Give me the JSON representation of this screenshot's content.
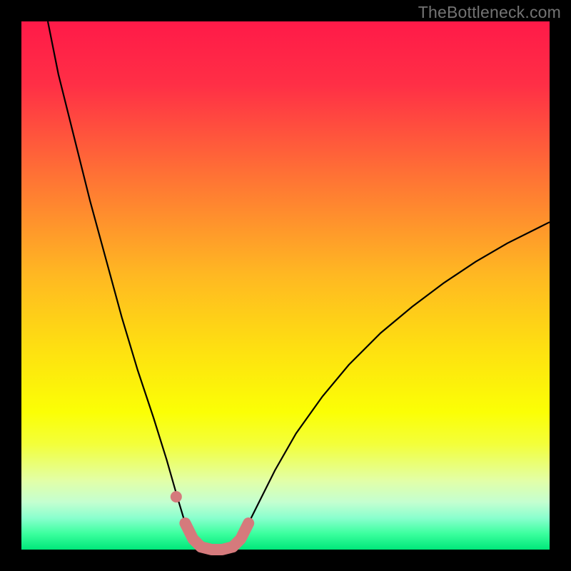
{
  "watermark": "TheBottleneck.com",
  "chart_data": {
    "type": "line",
    "title": "",
    "xlabel": "",
    "ylabel": "",
    "xlim": [
      0,
      100
    ],
    "ylim": [
      0,
      100
    ],
    "grid": false,
    "gradient_stops": [
      {
        "pos": 0.0,
        "color": "#ff1a48"
      },
      {
        "pos": 0.12,
        "color": "#ff2f46"
      },
      {
        "pos": 0.3,
        "color": "#ff7534"
      },
      {
        "pos": 0.48,
        "color": "#ffb822"
      },
      {
        "pos": 0.62,
        "color": "#fee011"
      },
      {
        "pos": 0.74,
        "color": "#fbff05"
      },
      {
        "pos": 0.8,
        "color": "#f3ff3a"
      },
      {
        "pos": 0.87,
        "color": "#e2ffa8"
      },
      {
        "pos": 0.91,
        "color": "#c4ffd0"
      },
      {
        "pos": 0.94,
        "color": "#8affce"
      },
      {
        "pos": 0.97,
        "color": "#3bff9e"
      },
      {
        "pos": 1.0,
        "color": "#00e77a"
      }
    ],
    "series": [
      {
        "name": "bottleneck-curve",
        "stroke": "#000000",
        "stroke_width": 2.2,
        "points": [
          {
            "x": 5.0,
            "y": 100.0
          },
          {
            "x": 7.0,
            "y": 90.0
          },
          {
            "x": 10.0,
            "y": 78.0
          },
          {
            "x": 13.0,
            "y": 66.0
          },
          {
            "x": 16.0,
            "y": 55.0
          },
          {
            "x": 19.0,
            "y": 44.0
          },
          {
            "x": 22.0,
            "y": 34.0
          },
          {
            "x": 25.0,
            "y": 25.0
          },
          {
            "x": 27.5,
            "y": 17.0
          },
          {
            "x": 29.5,
            "y": 10.0
          },
          {
            "x": 31.0,
            "y": 5.0
          },
          {
            "x": 32.5,
            "y": 2.0
          },
          {
            "x": 34.0,
            "y": 0.5
          },
          {
            "x": 36.0,
            "y": 0.0
          },
          {
            "x": 38.0,
            "y": 0.0
          },
          {
            "x": 40.0,
            "y": 0.5
          },
          {
            "x": 41.5,
            "y": 2.0
          },
          {
            "x": 43.0,
            "y": 5.0
          },
          {
            "x": 45.0,
            "y": 9.0
          },
          {
            "x": 48.0,
            "y": 15.0
          },
          {
            "x": 52.0,
            "y": 22.0
          },
          {
            "x": 57.0,
            "y": 29.0
          },
          {
            "x": 62.0,
            "y": 35.0
          },
          {
            "x": 68.0,
            "y": 41.0
          },
          {
            "x": 74.0,
            "y": 46.0
          },
          {
            "x": 80.0,
            "y": 50.5
          },
          {
            "x": 86.0,
            "y": 54.5
          },
          {
            "x": 92.0,
            "y": 58.0
          },
          {
            "x": 98.0,
            "y": 61.0
          },
          {
            "x": 100.0,
            "y": 62.0
          }
        ]
      },
      {
        "name": "highlight-band",
        "stroke": "#d57a7c",
        "stroke_width": 16,
        "linecap": "round",
        "points": [
          {
            "x": 31.0,
            "y": 5.0
          },
          {
            "x": 32.5,
            "y": 2.0
          },
          {
            "x": 34.0,
            "y": 0.5
          },
          {
            "x": 36.0,
            "y": 0.0
          },
          {
            "x": 38.0,
            "y": 0.0
          },
          {
            "x": 40.0,
            "y": 0.5
          },
          {
            "x": 41.5,
            "y": 2.0
          },
          {
            "x": 43.0,
            "y": 5.0
          }
        ]
      },
      {
        "name": "highlight-dot",
        "type_hint": "scatter",
        "fill": "#d57a7c",
        "radius": 8,
        "points": [
          {
            "x": 29.3,
            "y": 10.0
          }
        ]
      }
    ]
  }
}
